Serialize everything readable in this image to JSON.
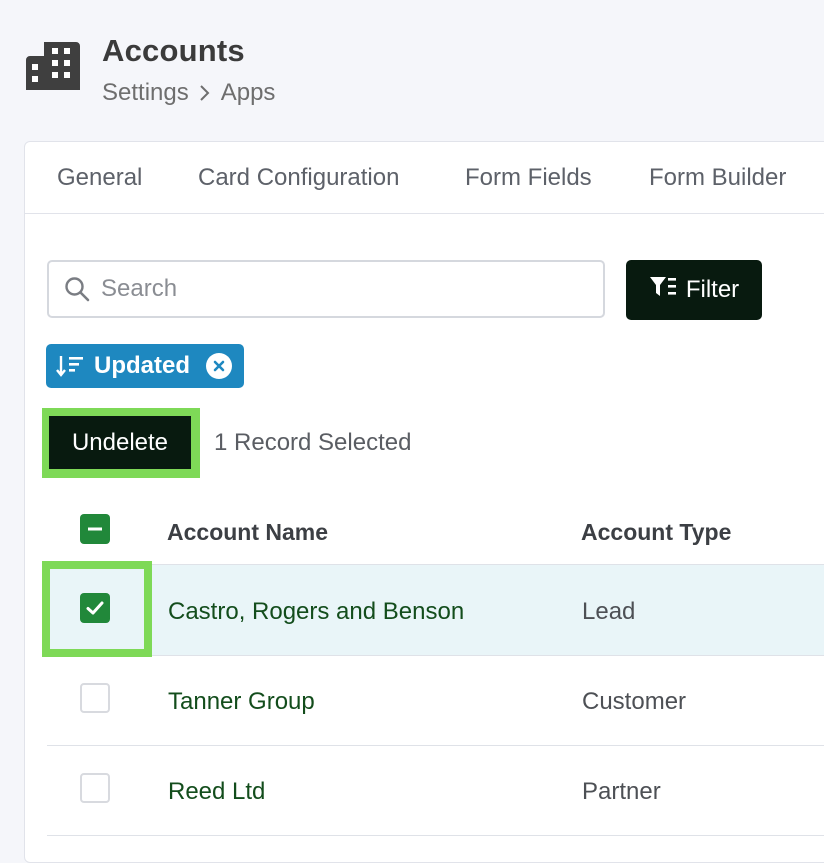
{
  "header": {
    "title": "Accounts",
    "breadcrumb": [
      "Settings",
      "Apps"
    ]
  },
  "tabs": [
    "General",
    "Card Configuration",
    "Form Fields",
    "Form Builder"
  ],
  "search": {
    "placeholder": "Search",
    "value": ""
  },
  "filter_button": {
    "label": "Filter"
  },
  "sort_chip": {
    "label": "Updated"
  },
  "bulk_actions": {
    "undelete_label": "Undelete",
    "selected_text": "1 Record Selected"
  },
  "table": {
    "columns": [
      "Account Name",
      "Account Type"
    ],
    "rows": [
      {
        "name": "Castro, Rogers and Benson",
        "type": "Lead",
        "checked": true
      },
      {
        "name": "Tanner Group",
        "type": "Customer",
        "checked": false
      },
      {
        "name": "Reed Ltd",
        "type": "Partner",
        "checked": false
      }
    ]
  },
  "colors": {
    "accent_dark": "#081a0f",
    "chip_blue": "#1e88c0",
    "checkbox_green": "#21883a",
    "highlight_green": "#7ed957",
    "link_green": "#134d1c",
    "selected_row": "#e9f5f8"
  },
  "icons": {
    "app": "building-icon",
    "breadcrumb_separator": "chevron-right-icon",
    "search": "search-icon",
    "filter": "filter-icon",
    "sort": "sort-descending-icon",
    "chip_remove": "close-icon",
    "select_all": "minus-icon",
    "row_check": "checkmark-icon"
  }
}
